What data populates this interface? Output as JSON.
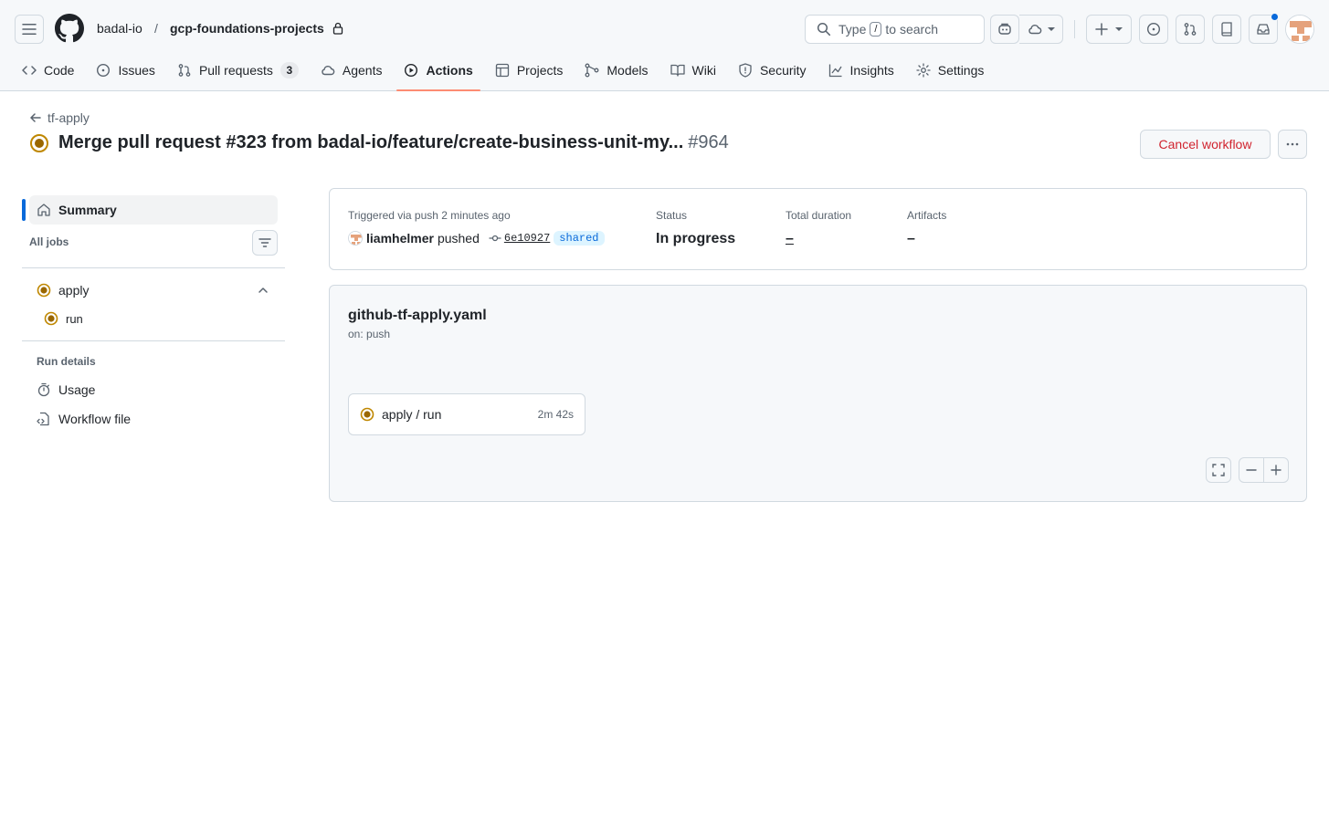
{
  "header": {
    "owner": "badal-io",
    "separator": "/",
    "repo": "gcp-foundations-projects",
    "search": {
      "prefix": "Type",
      "key": "/",
      "suffix": "to search"
    }
  },
  "nav": {
    "tabs": [
      {
        "label": "Code",
        "icon": "code-icon"
      },
      {
        "label": "Issues",
        "icon": "issue-icon"
      },
      {
        "label": "Pull requests",
        "icon": "pull-request-icon",
        "count": "3"
      },
      {
        "label": "Agents",
        "icon": "agents-icon"
      },
      {
        "label": "Actions",
        "icon": "play-icon",
        "active": true
      },
      {
        "label": "Projects",
        "icon": "table-icon"
      },
      {
        "label": "Models",
        "icon": "models-icon"
      },
      {
        "label": "Wiki",
        "icon": "book-icon"
      },
      {
        "label": "Security",
        "icon": "shield-icon"
      },
      {
        "label": "Insights",
        "icon": "graph-icon"
      },
      {
        "label": "Settings",
        "icon": "gear-icon"
      }
    ]
  },
  "run": {
    "back_label": "tf-apply",
    "title": "Merge pull request #323 from badal-io/feature/create-business-unit-my...",
    "number": "#964",
    "cancel_label": "Cancel workflow"
  },
  "sidebar": {
    "summary_label": "Summary",
    "all_jobs_label": "All jobs",
    "jobs": [
      {
        "label": "apply",
        "steps": [
          {
            "label": "run"
          }
        ]
      }
    ],
    "run_details_label": "Run details",
    "links": [
      {
        "label": "Usage",
        "icon": "stopwatch-icon"
      },
      {
        "label": "Workflow file",
        "icon": "file-code-icon"
      }
    ]
  },
  "summary": {
    "trigger_label": "Triggered via push 2 minutes ago",
    "actor": "liamhelmer",
    "action": "pushed",
    "commit": "6e10927",
    "branch": "shared",
    "status_label": "Status",
    "status_value": "In progress",
    "duration_label": "Total duration",
    "duration_value": "–",
    "artifacts_label": "Artifacts",
    "artifacts_value": "–"
  },
  "graph": {
    "workflow_file": "github-tf-apply.yaml",
    "trigger": "on: push",
    "job_node": {
      "label": "apply / run",
      "time": "2m 42s"
    }
  },
  "colors": {
    "accent": "#0969da",
    "danger": "#d1242f",
    "in_progress": "#bf8700",
    "active_tab_underline": "#fd8c73"
  }
}
